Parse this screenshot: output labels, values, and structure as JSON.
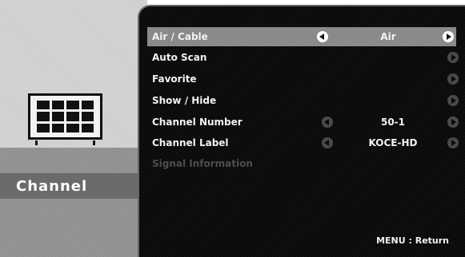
{
  "sidebar": {
    "section_label": "Channel",
    "icon": "tv-grid-icon"
  },
  "menu": {
    "items": [
      {
        "label": "Air / Cable",
        "value": "Air",
        "selected": true
      },
      {
        "label": "Auto Scan",
        "value": ""
      },
      {
        "label": "Favorite",
        "value": ""
      },
      {
        "label": "Show / Hide",
        "value": ""
      },
      {
        "label": "Channel Number",
        "value": "50-1"
      },
      {
        "label": "Channel Label",
        "value": "KOCE-HD"
      },
      {
        "label": "Signal Information",
        "value": "",
        "disabled": true
      }
    ]
  },
  "footer": {
    "hint": "MENU : Return"
  },
  "colors": {
    "menu_bg": "#0a0a0a",
    "selected_row": "#8a8a8a",
    "sidebar_label_bg": "#6b6b6b"
  }
}
